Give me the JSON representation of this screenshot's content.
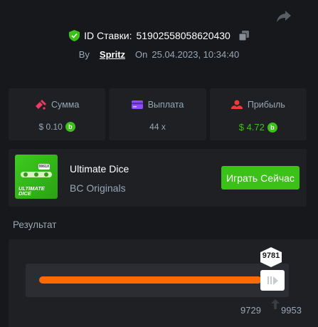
{
  "header": {
    "bet_id_label": "ID Ставки:",
    "bet_id": "51902558058620430",
    "by_label": "By",
    "user": "Spritz",
    "on_label": "On",
    "date": "25.04.2023, 10:34:40"
  },
  "stats": [
    {
      "label": "Сумма",
      "value": "$ 0.10",
      "icon": "bet-amount-icon",
      "color": "#ef3a63"
    },
    {
      "label": "Выплата",
      "value": "44 x",
      "icon": "payout-icon",
      "color": "#8f4cff"
    },
    {
      "label": "Прибыль",
      "value": "$ 4.72",
      "icon": "profit-icon",
      "color": "#ef3a3a"
    }
  ],
  "game": {
    "thumb_label_1": "ULTIMATE",
    "thumb_label_2": "DICE",
    "thumb_badge": "9961X",
    "title": "Ultimate Dice",
    "provider": "BC Originals",
    "play_label": "Играть Сейчас"
  },
  "result": {
    "title": "Результат",
    "roll": "9781",
    "range_low": "9729",
    "range_high": "9953",
    "fill_fraction": 0.9781
  },
  "colors": {
    "accent_green": "#3bc117",
    "slider_fill": "#ff6a00",
    "muted_text": "#98a7b5",
    "card_bg": "#1e2024"
  }
}
